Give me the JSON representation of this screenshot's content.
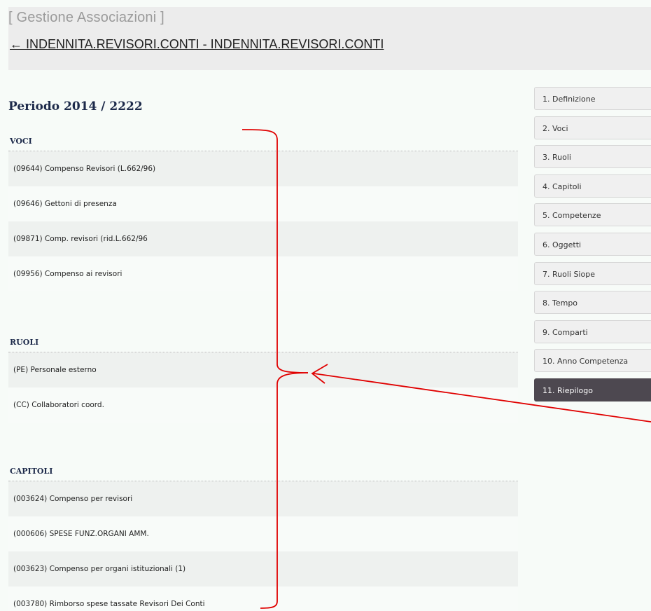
{
  "header": {
    "app_title": "[ Gestione Associazioni ]",
    "back_link": "← INDENNITA.REVISORI.CONTI - INDENNITA.REVISORI.CONTI"
  },
  "period_title": "Periodo 2014 / 2222",
  "sections": {
    "voci": {
      "title": "VOCI",
      "items": [
        "(09644) Compenso Revisori (L.662/96)",
        "(09646) Gettoni di presenza",
        "(09871) Comp. revisori (rid.L.662/96",
        "(09956) Compenso ai revisori"
      ]
    },
    "ruoli": {
      "title": "RUOLI",
      "items": [
        "(PE) Personale esterno",
        "(CC) Collaboratori coord."
      ]
    },
    "capitoli": {
      "title": "CAPITOLI",
      "items": [
        "(003624) Compenso per revisori",
        "(000606) SPESE FUNZ.ORGANI AMM.",
        "(003623) Compenso per organi istituzionali (1)",
        "(003780) Rimborso spese tassate Revisori Dei Conti"
      ]
    }
  },
  "steps": [
    "1. Definizione",
    "2. Voci",
    "3. Ruoli",
    "4. Capitoli",
    "5. Competenze",
    "6. Oggetti",
    "7. Ruoli Siope",
    "8. Tempo",
    "9. Comparti",
    "10. Anno Competenza",
    "11. Riepilogo"
  ],
  "active_step": "11. Riepilogo",
  "colors": {
    "accent_dark": "#4d4850",
    "annotation_red": "#e00000",
    "title_navy": "#1d2a4a"
  }
}
